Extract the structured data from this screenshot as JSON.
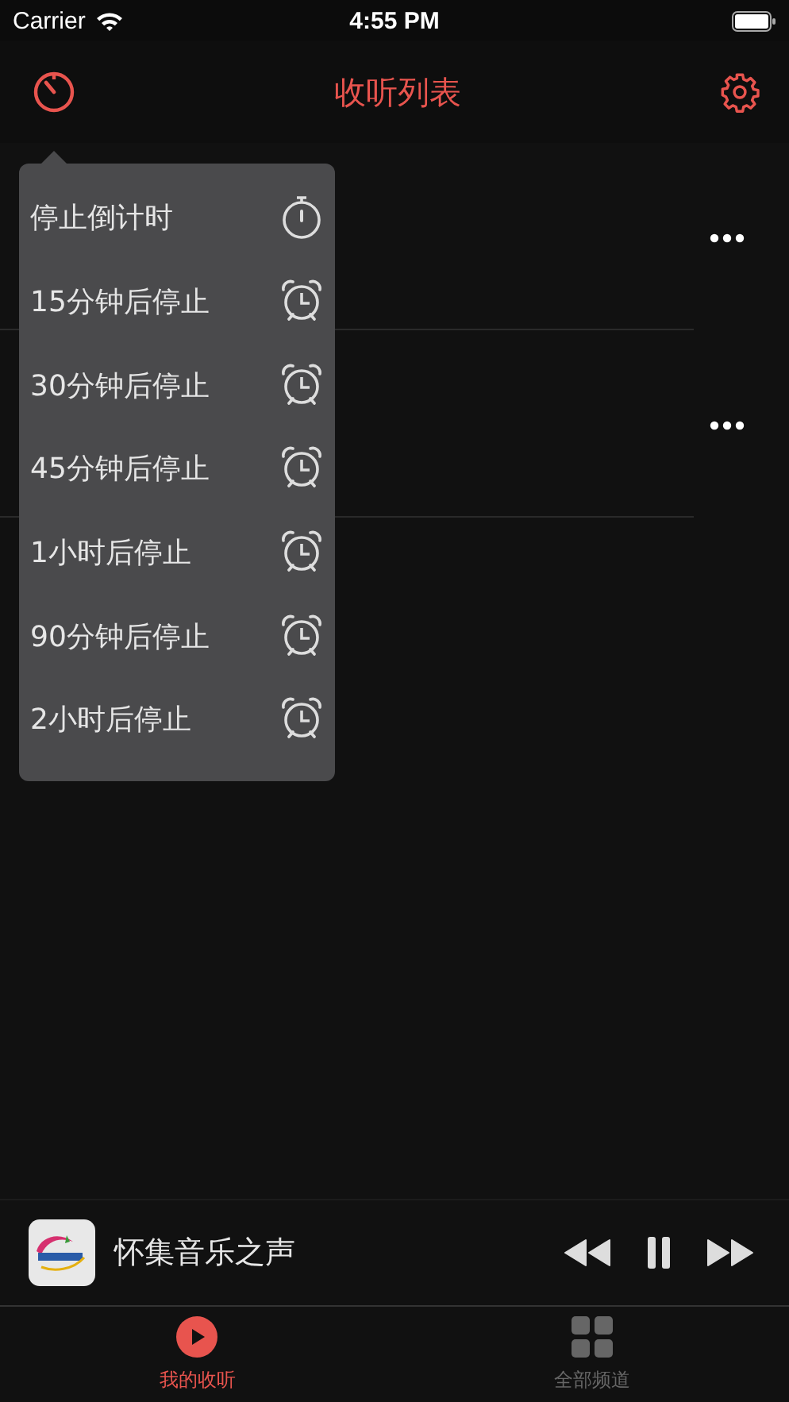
{
  "status_bar": {
    "carrier": "Carrier",
    "time": "4:55 PM"
  },
  "nav": {
    "title": "收听列表"
  },
  "list": {
    "rows": [
      {
        "kind": "station"
      },
      {
        "kind": "station"
      }
    ]
  },
  "timer_menu": {
    "items": [
      {
        "label": "停止倒计时",
        "kind": "stopwatch"
      },
      {
        "label": "15分钟后停止",
        "kind": "alarm"
      },
      {
        "label": "30分钟后停止",
        "kind": "alarm"
      },
      {
        "label": "45分钟后停止",
        "kind": "alarm"
      },
      {
        "label": "1小时后停止",
        "kind": "alarm"
      },
      {
        "label": "90分钟后停止",
        "kind": "alarm"
      },
      {
        "label": "2小时后停止",
        "kind": "alarm"
      }
    ]
  },
  "player": {
    "station": "怀集音乐之声",
    "playing": true
  },
  "tabs": [
    {
      "label": "我的收听",
      "selected": true,
      "kind": "play"
    },
    {
      "label": "全部频道",
      "selected": false,
      "kind": "grid"
    }
  ]
}
